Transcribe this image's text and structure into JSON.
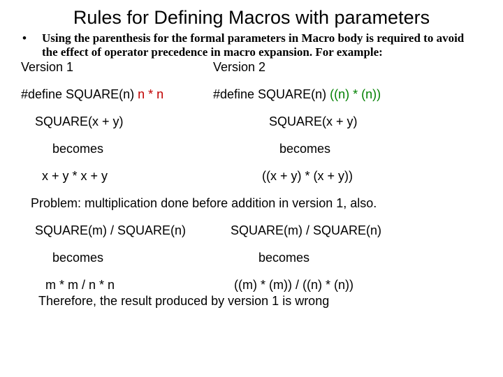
{
  "title": "Rules for Defining Macros with parameters",
  "bullet": {
    "dot": "•",
    "text": "Using the parenthesis for the formal parameters in Macro body is required to avoid the effect of operator precedence in macro expansion. For example:"
  },
  "version1_label": "Version 1",
  "version2_label": "Version 2",
  "def1_prefix": "#define SQUARE(n)  ",
  "def1_body": "n * n",
  "def2_prefix": "#define SQUARE(n)  ",
  "def2_body": "((n) * (n))",
  "call1_left": "SQUARE(x + y)",
  "call1_right": "SQUARE(x + y)",
  "becomes": "becomes",
  "exp1_left": "x + y * x + y",
  "exp1_right": "((x + y) * (x + y))",
  "problem": "Problem: multiplication done  before addition in version 1, also.",
  "call2_left": "SQUARE(m) / SQUARE(n)",
  "call2_right": "SQUARE(m) / SQUARE(n)",
  "exp2_left": "m * m / n * n",
  "exp2_right": "((m) * (m)) / ((n) * (n))",
  "therefore": "Therefore, the result produced by  version 1 is wrong"
}
